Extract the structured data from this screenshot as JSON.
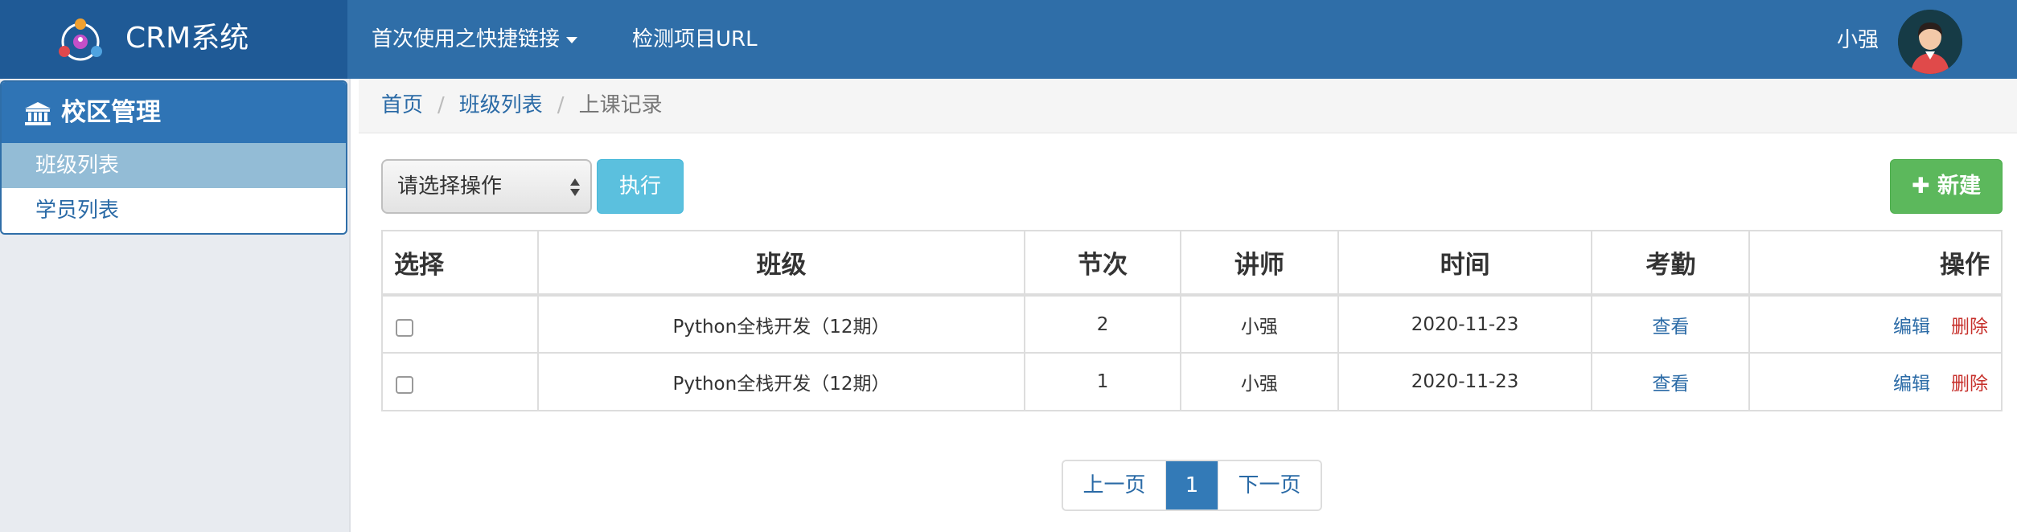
{
  "header": {
    "brand": "CRM系统",
    "nav": [
      {
        "label": "首次使用之快捷链接",
        "has_dropdown": true
      },
      {
        "label": "检测项目URL"
      }
    ],
    "user": "小强"
  },
  "sidebar": {
    "section": "校区管理",
    "section_icon": "bank-icon",
    "items": [
      {
        "label": "班级列表",
        "active": true
      },
      {
        "label": "学员列表",
        "active": false
      }
    ]
  },
  "breadcrumb": [
    "首页",
    "班级列表",
    "上课记录"
  ],
  "toolbar": {
    "select_value": "请选择操作",
    "execute_label": "执行",
    "new_label": "新建",
    "new_icon": "plus-icon"
  },
  "table": {
    "headers": [
      "选择",
      "班级",
      "节次",
      "讲师",
      "时间",
      "考勤",
      "操作"
    ],
    "rows": [
      {
        "class": "Python全栈开发（12期）",
        "session": "2",
        "teacher": "小强",
        "time": "2020-11-23",
        "attendance": "查看",
        "edit": "编辑",
        "delete": "删除"
      },
      {
        "class": "Python全栈开发（12期）",
        "session": "1",
        "teacher": "小强",
        "time": "2020-11-23",
        "attendance": "查看",
        "edit": "编辑",
        "delete": "删除"
      }
    ]
  },
  "pagination": {
    "prev": "上一页",
    "current": "1",
    "next": "下一页"
  },
  "colors": {
    "topbar": "#2f6ea8",
    "brand_bg": "#1f5a96",
    "link": "#2a6aa6",
    "danger": "#c7312c",
    "success": "#5cb85c",
    "info": "#5bc0de",
    "sidebar_active": "#93bcd6"
  }
}
